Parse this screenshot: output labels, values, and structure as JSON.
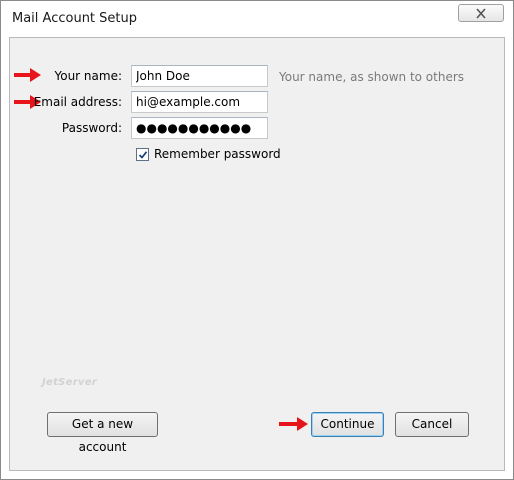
{
  "window": {
    "title": "Mail Account Setup"
  },
  "form": {
    "name_label": "Your name:",
    "name_value": "John Doe",
    "name_hint": "Your name, as shown to others",
    "email_label": "Email address:",
    "email_value": "hi@example.com",
    "password_label": "Password:",
    "password_value": "●●●●●●●●●●●",
    "remember_label": "Remember password",
    "remember_checked": true
  },
  "watermark": "JetServer",
  "buttons": {
    "get_account_label": "Get a new account",
    "continue_label": "Continue",
    "cancel_label": "Cancel"
  },
  "colors": {
    "annotation_arrow": "#e8141b",
    "dialog_background": "#f0f0f0"
  }
}
